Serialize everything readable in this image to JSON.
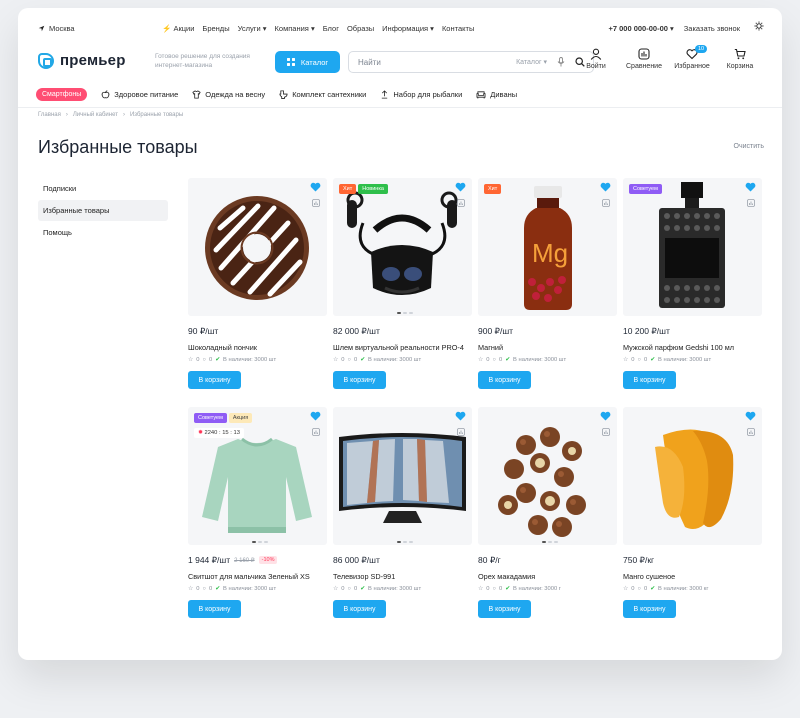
{
  "topbar": {
    "city": "Москва",
    "nav": [
      "Акции",
      "Бренды",
      "Услуги",
      "Компания",
      "Блог",
      "Образы",
      "Информация",
      "Контакты"
    ],
    "phone": "+7 000 000-00-00",
    "callback": "Заказать звонок"
  },
  "header": {
    "logo": "премьер",
    "tagline": "Готовое решение для создания интернет-магазина",
    "catalog": "Каталог",
    "search_placeholder": "Найти",
    "search_scope": "Каталог",
    "icons": [
      {
        "label": "Войти",
        "icon": "user-icon"
      },
      {
        "label": "Сравнение",
        "icon": "compare-icon"
      },
      {
        "label": "Избранное",
        "icon": "heart-icon",
        "badge": "10"
      },
      {
        "label": "Корзина",
        "icon": "cart-icon"
      }
    ]
  },
  "categories": [
    {
      "label": "Смартфоны",
      "highlight": true
    },
    {
      "label": "Здоровое питание",
      "icon": "apple-icon"
    },
    {
      "label": "Одежда на весну",
      "icon": "shirt-icon"
    },
    {
      "label": "Комплект сантехники",
      "icon": "toilet-icon"
    },
    {
      "label": "Набор для рыбалки",
      "icon": "fish-icon"
    },
    {
      "label": "Диваны",
      "icon": "sofa-icon"
    }
  ],
  "breadcrumbs": [
    "Главная",
    "Личный кабинет",
    "Избранные товары"
  ],
  "page": {
    "title": "Избранные товары",
    "clear": "Очистить"
  },
  "sidebar": [
    "Подписки",
    "Избранные товары",
    "Помощь"
  ],
  "cart_label": "В корзину",
  "products": [
    {
      "price": "90 ₽/шт",
      "name": "Шоколадный пончик",
      "rating": "0",
      "reviews": "0",
      "stock": "В наличии: 3000 шт",
      "tags": []
    },
    {
      "price": "82 000 ₽/шт",
      "name": "Шлем виртуальной реальности PRO-4",
      "rating": "0",
      "reviews": "0",
      "stock": "В наличии: 3000 шт",
      "tags": [
        "Хит",
        "Новинка"
      ]
    },
    {
      "price": "900 ₽/шт",
      "name": "Магний",
      "rating": "0",
      "reviews": "0",
      "stock": "В наличии: 3000 шт",
      "tags": [
        "Хит"
      ]
    },
    {
      "price": "10 200 ₽/шт",
      "name": "Мужской парфюм Gedshi 100 мл",
      "rating": "0",
      "reviews": "0",
      "stock": "В наличии: 3000 шт",
      "tags": [
        "Советуем"
      ]
    },
    {
      "price": "1 944 ₽/шт",
      "old_price": "2 160 ₽",
      "discount": "-10%",
      "name": "Свитшот для мальчика Зеленый XS",
      "rating": "0",
      "reviews": "0",
      "stock": "В наличии: 3000 шт",
      "tags": [
        "Советуем",
        "Акция"
      ],
      "timer": "2240 : 15 : 13"
    },
    {
      "price": "86 000 ₽/шт",
      "name": "Телевизор SD-991",
      "rating": "0",
      "reviews": "0",
      "stock": "В наличии: 3000 шт",
      "tags": []
    },
    {
      "price": "80 ₽/г",
      "name": "Орех макадамия",
      "rating": "0",
      "reviews": "0",
      "stock": "В наличии: 3000 г",
      "tags": []
    },
    {
      "price": "750 ₽/кг",
      "name": "Манго сушеное",
      "rating": "0",
      "reviews": "0",
      "stock": "В наличии: 3000 кг",
      "tags": []
    }
  ],
  "colors": {
    "accent": "#1ea7f0",
    "pill": "#ff4d73",
    "hit": "#ff6633",
    "new": "#2fbf4b",
    "advise": "#8f5cf5",
    "sale": "#fde9b8"
  }
}
